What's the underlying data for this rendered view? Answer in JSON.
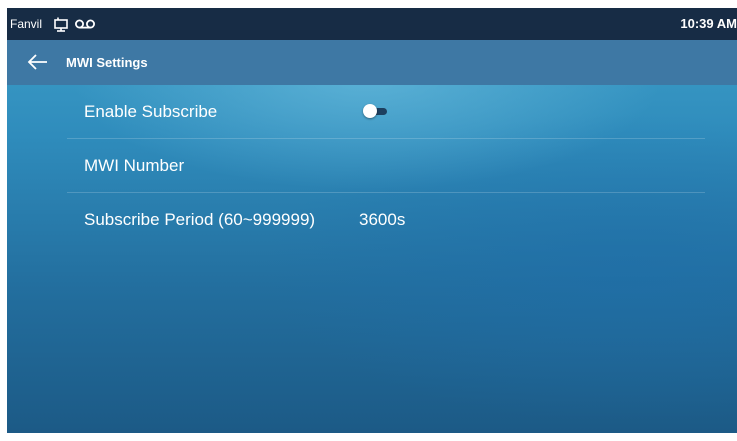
{
  "status_bar": {
    "brand": "Fanvil",
    "icons": [
      "network-icon",
      "voicemail-icon"
    ],
    "time": "10:39 AM"
  },
  "title_bar": {
    "back_icon": "arrow-left-icon",
    "title": "MWI Settings"
  },
  "settings": {
    "enable_subscribe": {
      "label": "Enable Subscribe",
      "enabled": false
    },
    "mwi_number": {
      "label": "MWI Number",
      "value": ""
    },
    "subscribe_period": {
      "label": "Subscribe Period (60~999999)",
      "value": "3600s"
    }
  },
  "colors": {
    "status_bar_bg": "#172c45",
    "title_bar_bg": "#3e78a4",
    "background_top": "#3fa0c9",
    "background_bottom": "#1c5a86",
    "text": "#ffffff"
  }
}
